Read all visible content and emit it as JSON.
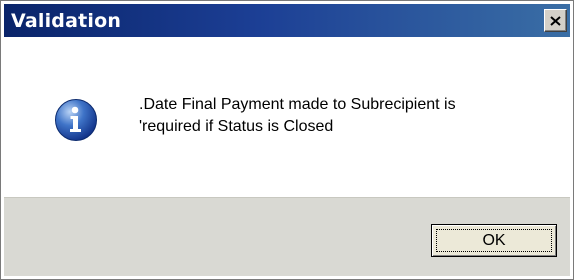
{
  "window": {
    "title": "Validation",
    "close_icon": "close-icon"
  },
  "message": {
    "icon": "info-icon",
    "line1": ".Date Final Payment made to Subrecipient is",
    "line2": "'required if Status is Closed"
  },
  "buttons": {
    "ok_label": "OK"
  },
  "colors": {
    "titlebar_start": "#0a246a",
    "titlebar_end": "#3a6ea5",
    "footer": "#d9d9d3"
  }
}
